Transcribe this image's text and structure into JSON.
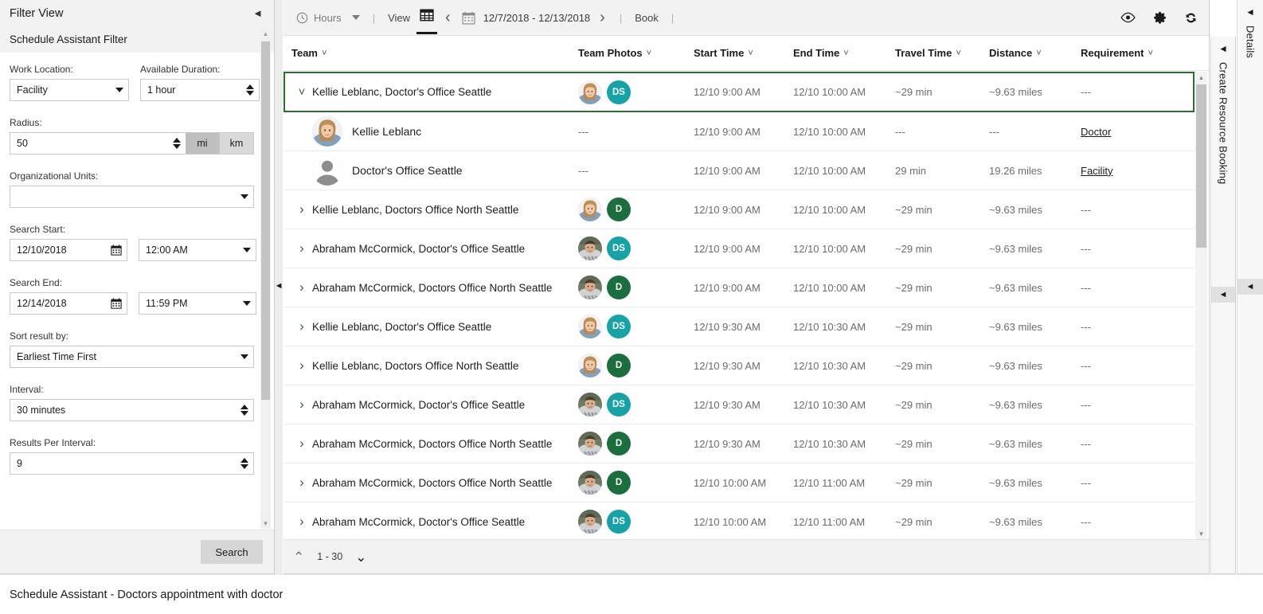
{
  "filter_panel": {
    "title": "Filter View",
    "collapse_icon": "caret-left-icon",
    "subtitle": "Schedule Assistant Filter",
    "fields": {
      "work_location_label": "Work Location:",
      "work_location_value": "Facility",
      "available_duration_label": "Available Duration:",
      "available_duration_value": "1 hour",
      "radius_label": "Radius:",
      "radius_value": "50",
      "unit_mi": "mi",
      "unit_km": "km",
      "unit_selected": "mi",
      "org_units_label": "Organizational Units:",
      "org_units_value": "",
      "search_start_label": "Search Start:",
      "search_start_date": "12/10/2018",
      "search_start_time": "12:00 AM",
      "search_end_label": "Search End:",
      "search_end_date": "12/14/2018",
      "search_end_time": "11:59 PM",
      "sort_label": "Sort result by:",
      "sort_value": "Earliest Time First",
      "interval_label": "Interval:",
      "interval_value": "30 minutes",
      "results_per_interval_label": "Results Per Interval:",
      "results_per_interval_value": "9"
    },
    "search_button": "Search"
  },
  "toolbar": {
    "hours_label": "Hours",
    "view_label": "View",
    "date_range": "12/7/2018 - 12/13/2018",
    "book_label": "Book",
    "separator": "|",
    "icons": {
      "clock": "clock-icon",
      "hours_caret": "caret-down-icon",
      "grid": "grid-view-icon",
      "prev": "chevron-left-icon",
      "calendar": "calendar-icon",
      "next": "chevron-right-icon",
      "eye": "eye-icon",
      "gear": "gear-icon",
      "refresh": "refresh-icon"
    }
  },
  "grid": {
    "columns": [
      "Team",
      "Team Photos",
      "Start Time",
      "End Time",
      "Travel Time",
      "Distance",
      "Requirement"
    ],
    "selection_color": "#2c7031",
    "badge_colors": {
      "DS": "#15a3a8",
      "D": "#1b6e3e"
    },
    "rows": [
      {
        "team": "Kellie Leblanc, Doctor's Office Seattle",
        "expanded": true,
        "selected": true,
        "avatar": "woman-avatar",
        "badge": "DS",
        "start": "12/10 9:00 AM",
        "end": "12/10 10:00 AM",
        "travel": "~29 min",
        "distance": "~9.63 miles",
        "requirement": "---",
        "children": [
          {
            "name": "Kellie Leblanc",
            "avatar": "woman-avatar",
            "photos": "---",
            "start": "12/10 9:00 AM",
            "end": "12/10 10:00 AM",
            "travel": "---",
            "distance": "---",
            "requirement": "Doctor"
          },
          {
            "name": "Doctor's Office Seattle",
            "avatar": "generic-person-avatar",
            "photos": "---",
            "start": "12/10 9:00 AM",
            "end": "12/10 10:00 AM",
            "travel": "29 min",
            "distance": "19.26 miles",
            "requirement": "Facility"
          }
        ]
      },
      {
        "team": "Kellie Leblanc, Doctors Office North Seattle",
        "expanded": false,
        "selected": false,
        "avatar": "woman-avatar",
        "badge": "D",
        "start": "12/10 9:00 AM",
        "end": "12/10 10:00 AM",
        "travel": "~29 min",
        "distance": "~9.63 miles",
        "requirement": "---"
      },
      {
        "team": "Abraham McCormick, Doctor's Office Seattle",
        "expanded": false,
        "selected": false,
        "avatar": "man-avatar",
        "badge": "DS",
        "start": "12/10 9:00 AM",
        "end": "12/10 10:00 AM",
        "travel": "~29 min",
        "distance": "~9.63 miles",
        "requirement": "---"
      },
      {
        "team": "Abraham McCormick, Doctors Office North Seattle",
        "expanded": false,
        "selected": false,
        "avatar": "man-avatar",
        "badge": "D",
        "start": "12/10 9:00 AM",
        "end": "12/10 10:00 AM",
        "travel": "~29 min",
        "distance": "~9.63 miles",
        "requirement": "---"
      },
      {
        "team": "Kellie Leblanc, Doctor's Office Seattle",
        "expanded": false,
        "selected": false,
        "avatar": "woman-avatar",
        "badge": "DS",
        "start": "12/10 9:30 AM",
        "end": "12/10 10:30 AM",
        "travel": "~29 min",
        "distance": "~9.63 miles",
        "requirement": "---"
      },
      {
        "team": "Kellie Leblanc, Doctors Office North Seattle",
        "expanded": false,
        "selected": false,
        "avatar": "woman-avatar",
        "badge": "D",
        "start": "12/10 9:30 AM",
        "end": "12/10 10:30 AM",
        "travel": "~29 min",
        "distance": "~9.63 miles",
        "requirement": "---"
      },
      {
        "team": "Abraham McCormick, Doctor's Office Seattle",
        "expanded": false,
        "selected": false,
        "avatar": "man-avatar",
        "badge": "DS",
        "start": "12/10 9:30 AM",
        "end": "12/10 10:30 AM",
        "travel": "~29 min",
        "distance": "~9.63 miles",
        "requirement": "---"
      },
      {
        "team": "Abraham McCormick, Doctors Office North Seattle",
        "expanded": false,
        "selected": false,
        "avatar": "man-avatar",
        "badge": "D",
        "start": "12/10 9:30 AM",
        "end": "12/10 10:30 AM",
        "travel": "~29 min",
        "distance": "~9.63 miles",
        "requirement": "---"
      },
      {
        "team": "Abraham McCormick, Doctors Office North Seattle",
        "expanded": false,
        "selected": false,
        "avatar": "man-avatar",
        "badge": "D",
        "start": "12/10 10:00 AM",
        "end": "12/10 11:00 AM",
        "travel": "~29 min",
        "distance": "~9.63 miles",
        "requirement": "---"
      },
      {
        "team": "Abraham McCormick, Doctor's Office Seattle",
        "expanded": false,
        "selected": false,
        "avatar": "man-avatar",
        "badge": "DS",
        "start": "12/10 10:00 AM",
        "end": "12/10 11:00 AM",
        "travel": "~29 min",
        "distance": "~9.63 miles",
        "requirement": "---"
      }
    ]
  },
  "pager": {
    "range": "1 - 30",
    "up_icon": "chevron-up-icon",
    "down_icon": "chevron-down-icon"
  },
  "right_panels": {
    "create_resource_booking": "Create Resource Booking",
    "details": "Details",
    "collapse_icon": "caret-left-icon"
  },
  "status_bar": {
    "text": "Schedule Assistant - Doctors appointment with doctor"
  }
}
